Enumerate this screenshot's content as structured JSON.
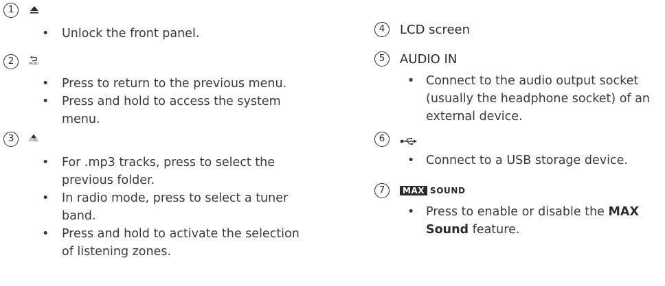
{
  "left": {
    "items": [
      {
        "number": "1",
        "icon": "eject-icon",
        "bullets": [
          "Unlock the front panel."
        ]
      },
      {
        "number": "2",
        "icon": "back-arrow-icon",
        "icon_label": "MENU",
        "bullets": [
          "Press to return to the previous menu.",
          "Press and hold to access the system menu."
        ]
      },
      {
        "number": "3",
        "icon": "up-triangle-icon",
        "icon_label": "ZONE",
        "bullets": [
          "For .mp3 tracks, press to select the previous folder.",
          "In radio mode, press to select a tuner band.",
          "Press and hold to activate the selection of listening zones."
        ]
      }
    ]
  },
  "right": {
    "items": [
      {
        "number": "4",
        "title": "LCD screen"
      },
      {
        "number": "5",
        "title": "AUDIO IN",
        "bullets": [
          "Connect to the audio output socket (usually the headphone socket) of an external device."
        ]
      },
      {
        "number": "6",
        "icon": "usb-icon",
        "bullets": [
          "Connect to a USB storage device."
        ]
      },
      {
        "number": "7",
        "logo_text": "MAX",
        "logo_suffix": "SOUND",
        "bullet_pre": "Press to enable or disable the",
        "bullet_strong": "MAX Sound",
        "bullet_post": "feature."
      }
    ]
  },
  "bullet_char": "•"
}
